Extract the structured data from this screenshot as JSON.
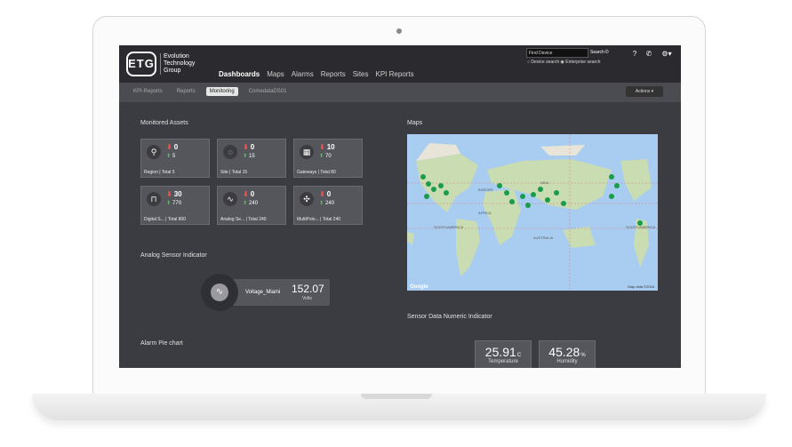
{
  "brand": {
    "mark": "ETG",
    "name_line1": "Evolution",
    "name_line2": "Technology",
    "name_line3": "Group"
  },
  "nav": {
    "items": [
      "Dashboards",
      "Maps",
      "Alarms",
      "Reports",
      "Sites",
      "KPI Reports"
    ],
    "active": "Dashboards"
  },
  "search": {
    "placeholder": "Find Device",
    "button": "Search",
    "option1": "Device search",
    "option2": "Enterprise search"
  },
  "header_icons": [
    "help-icon",
    "phone-icon",
    "gear-icon"
  ],
  "subnav": {
    "tabs": [
      "KPI-Reports",
      "Reports",
      "Monitoring",
      "ComedataDS01"
    ],
    "active": "Monitoring",
    "actions_label": "Actions"
  },
  "monitored_assets": {
    "title": "Monitored Assets",
    "tiles": [
      {
        "icon": "map-pin-icon",
        "down": "0",
        "up": "5",
        "label": "Region",
        "total": "Total 5"
      },
      {
        "icon": "site-icon",
        "down": "0",
        "up": "15",
        "label": "Site",
        "total": "Total 15"
      },
      {
        "icon": "gateway-icon",
        "down": "10",
        "up": "70",
        "label": "Gateways",
        "total": "Total 80"
      },
      {
        "icon": "digital-signal-icon",
        "down": "30",
        "up": "770",
        "label": "Digital S...",
        "total": "Total 800"
      },
      {
        "icon": "analog-wave-icon",
        "down": "0",
        "up": "240",
        "label": "Analog Se...",
        "total": "Total 240"
      },
      {
        "icon": "multipoint-icon",
        "down": "0",
        "up": "240",
        "label": "MultiPoin...",
        "total": "Total 240"
      }
    ]
  },
  "maps": {
    "title": "Maps",
    "credit": "Map data ©2016",
    "google": "Google",
    "labels": [
      "EUROPE",
      "ASIA",
      "AFRICA",
      "SOUTH AMERICA",
      "AUSTRALIA",
      "SOUTH AMERICA"
    ]
  },
  "analog_sensor": {
    "title": "Analog Sensor Indicator",
    "name": "Voltage_Miami",
    "value": "152.07",
    "unit": "Volts"
  },
  "sensor_numeric": {
    "title": "Sensor Data Numeric Indicator",
    "items": [
      {
        "value": "25.91",
        "unit": "C",
        "label": "Temperature"
      },
      {
        "value": "45.28",
        "unit": "%",
        "label": "Humidity"
      }
    ]
  },
  "alarm_pie": {
    "title": "Alarm Pie chart"
  },
  "colors": {
    "accent_red": "#e55555",
    "accent_green": "#44cc44",
    "panel": "#55565c",
    "bg": "#3b3c42"
  }
}
